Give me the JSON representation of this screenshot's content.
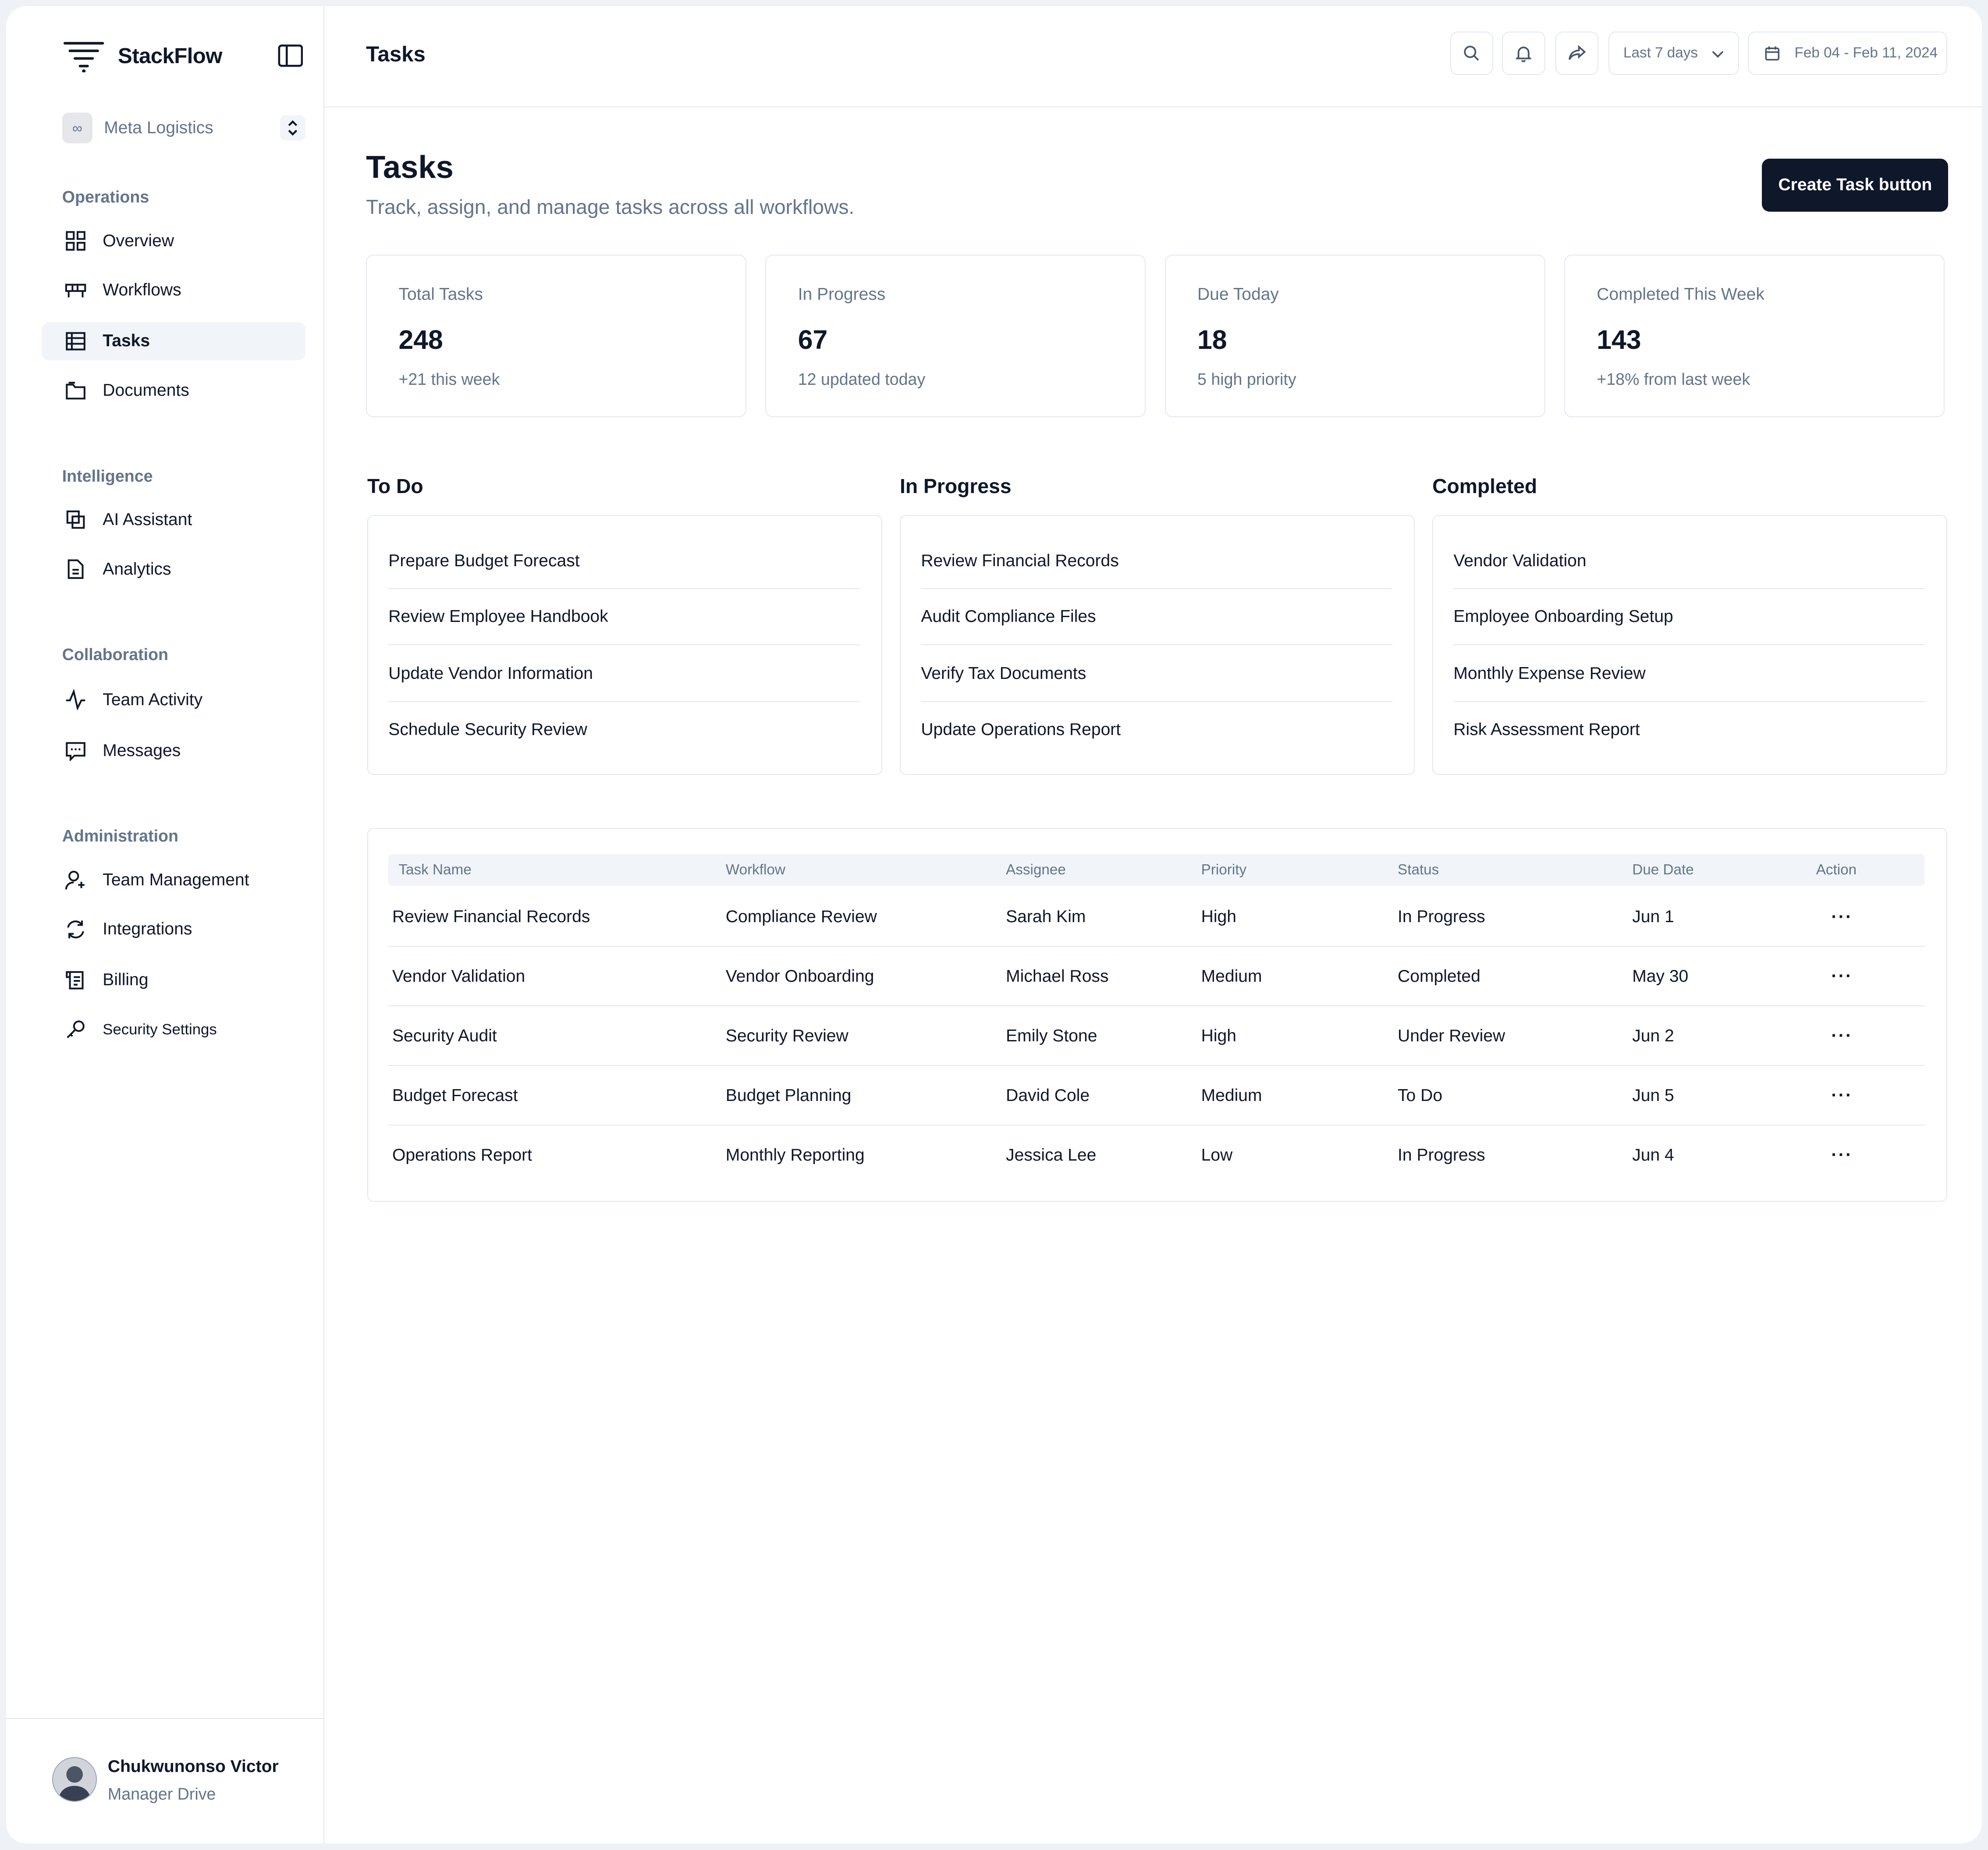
{
  "brand": {
    "name": "StackFlow"
  },
  "workspace": {
    "name": "Meta Logistics",
    "logo": "∞"
  },
  "sidebar": {
    "sections": [
      {
        "title": "Operations",
        "items": [
          {
            "label": "Overview",
            "icon": "grid-icon"
          },
          {
            "label": "Workflows",
            "icon": "workflow-icon"
          },
          {
            "label": "Tasks",
            "icon": "tasks-icon",
            "active": true
          },
          {
            "label": "Documents",
            "icon": "folder-icon"
          }
        ]
      },
      {
        "title": "Intelligence",
        "items": [
          {
            "label": "AI Assistant",
            "icon": "ai-icon"
          },
          {
            "label": "Analytics",
            "icon": "file-icon"
          }
        ]
      },
      {
        "title": "Collaboration",
        "items": [
          {
            "label": "Team Activity",
            "icon": "activity-icon"
          },
          {
            "label": "Messages",
            "icon": "message-icon"
          }
        ]
      },
      {
        "title": "Administration",
        "items": [
          {
            "label": "Team Management",
            "icon": "users-icon"
          },
          {
            "label": "Integrations",
            "icon": "refresh-icon"
          },
          {
            "label": "Billing",
            "icon": "receipt-icon"
          },
          {
            "label": "Security Settings",
            "icon": "key-icon"
          }
        ]
      }
    ]
  },
  "user": {
    "name": "Chukwunonso Victor",
    "role": "Manager Drive"
  },
  "topbar": {
    "title": "Tasks",
    "range": "Last 7 days",
    "date_range": "Feb 04 - Feb 11, 2024"
  },
  "page": {
    "title": "Tasks",
    "subtitle": "Track, assign, and manage tasks across all workflows.",
    "cta": "Create Task button"
  },
  "stats": [
    {
      "label": "Total Tasks",
      "value": "248",
      "note": "+21 this week"
    },
    {
      "label": "In Progress",
      "value": "67",
      "note": "12 updated today"
    },
    {
      "label": "Due Today",
      "value": "18",
      "note": "5 high priority"
    },
    {
      "label": "Completed This Week",
      "value": "143",
      "note": "+18% from last week"
    }
  ],
  "board": [
    {
      "title": "To Do",
      "items": [
        "Prepare Budget Forecast",
        "Review Employee Handbook",
        "Update Vendor Information",
        "Schedule Security Review"
      ]
    },
    {
      "title": "In Progress",
      "items": [
        "Review Financial Records",
        "Audit Compliance Files",
        "Verify Tax Documents",
        "Update Operations Report"
      ]
    },
    {
      "title": "Completed",
      "items": [
        "Vendor Validation",
        "Employee Onboarding Setup",
        "Monthly Expense Review",
        "Risk Assessment Report"
      ]
    }
  ],
  "table": {
    "headers": [
      "Task Name",
      "Workflow",
      "Assignee",
      "Priority",
      "Status",
      "Due Date",
      "Action"
    ],
    "rows": [
      [
        "Review Financial Records",
        "Compliance Review",
        "Sarah Kim",
        "High",
        "In Progress",
        "Jun 1"
      ],
      [
        "Vendor Validation",
        "Vendor Onboarding",
        "Michael Ross",
        "Medium",
        "Completed",
        "May 30"
      ],
      [
        "Security Audit",
        "Security Review",
        "Emily Stone",
        "High",
        "Under Review",
        "Jun 2"
      ],
      [
        "Budget Forecast",
        "Budget Planning",
        "David Cole",
        "Medium",
        "To Do",
        "Jun 5"
      ],
      [
        "Operations Report",
        "Monthly Reporting",
        "Jessica Lee",
        "Low",
        "In Progress",
        "Jun 4"
      ]
    ],
    "action_glyph": "···"
  },
  "colors": {
    "primary": "#0f172a",
    "muted": "#64748b",
    "border": "#e2e8f0",
    "active_bg": "#f1f5f9"
  }
}
